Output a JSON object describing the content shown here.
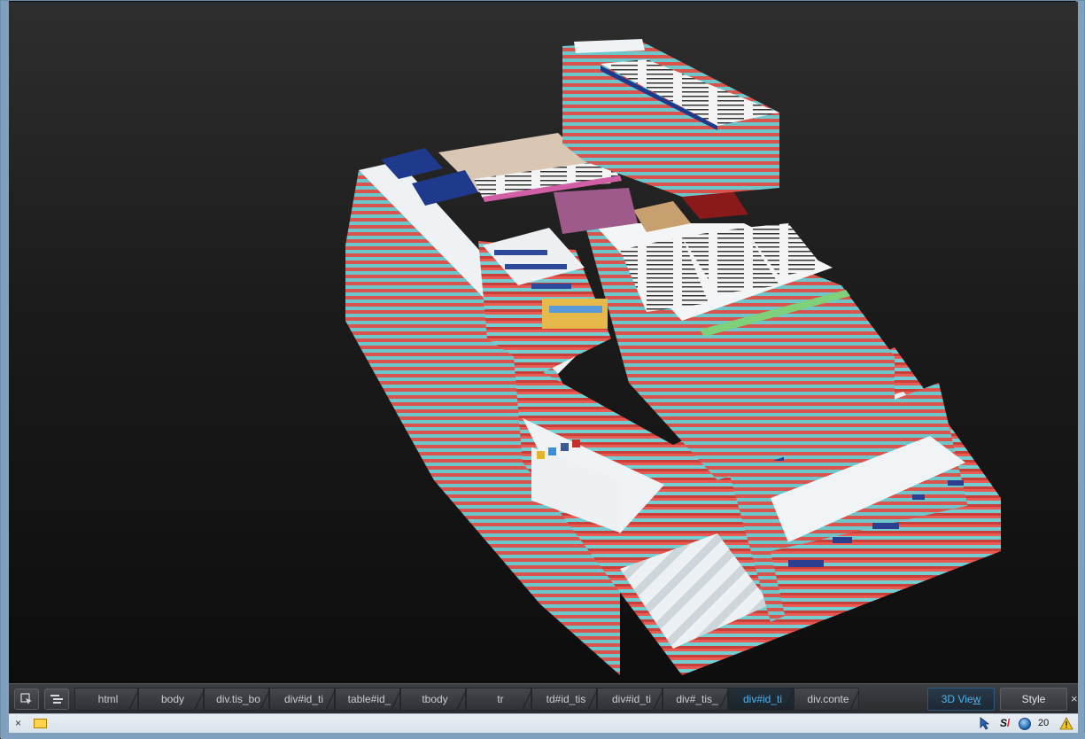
{
  "toolbar": {
    "select_element_icon": "select-element-icon",
    "dom_tree_icon": "dom-tree-icon",
    "breadcrumbs": [
      {
        "label": "html"
      },
      {
        "label": "body"
      },
      {
        "label": "div.tis_bo"
      },
      {
        "label": "div#id_ti"
      },
      {
        "label": "table#id_"
      },
      {
        "label": "tbody"
      },
      {
        "label": "tr"
      },
      {
        "label": "td#id_tis"
      },
      {
        "label": "div#id_ti"
      },
      {
        "label": "div#_tis_"
      },
      {
        "label": "div#id_ti"
      },
      {
        "label": "div.conte"
      }
    ],
    "selected_index": 10,
    "view_3d_label_pre": "3D Vie",
    "view_3d_label_u": "w",
    "style_label": "Style",
    "close_label": "×"
  },
  "statusbar": {
    "close_label": "×",
    "addon_count": "20"
  },
  "colors": {
    "layer_teal": "#67c4c7",
    "layer_red": "#e14b43",
    "layer_white": "#f2f5f7",
    "accent_blue": "#4fb3f0"
  }
}
